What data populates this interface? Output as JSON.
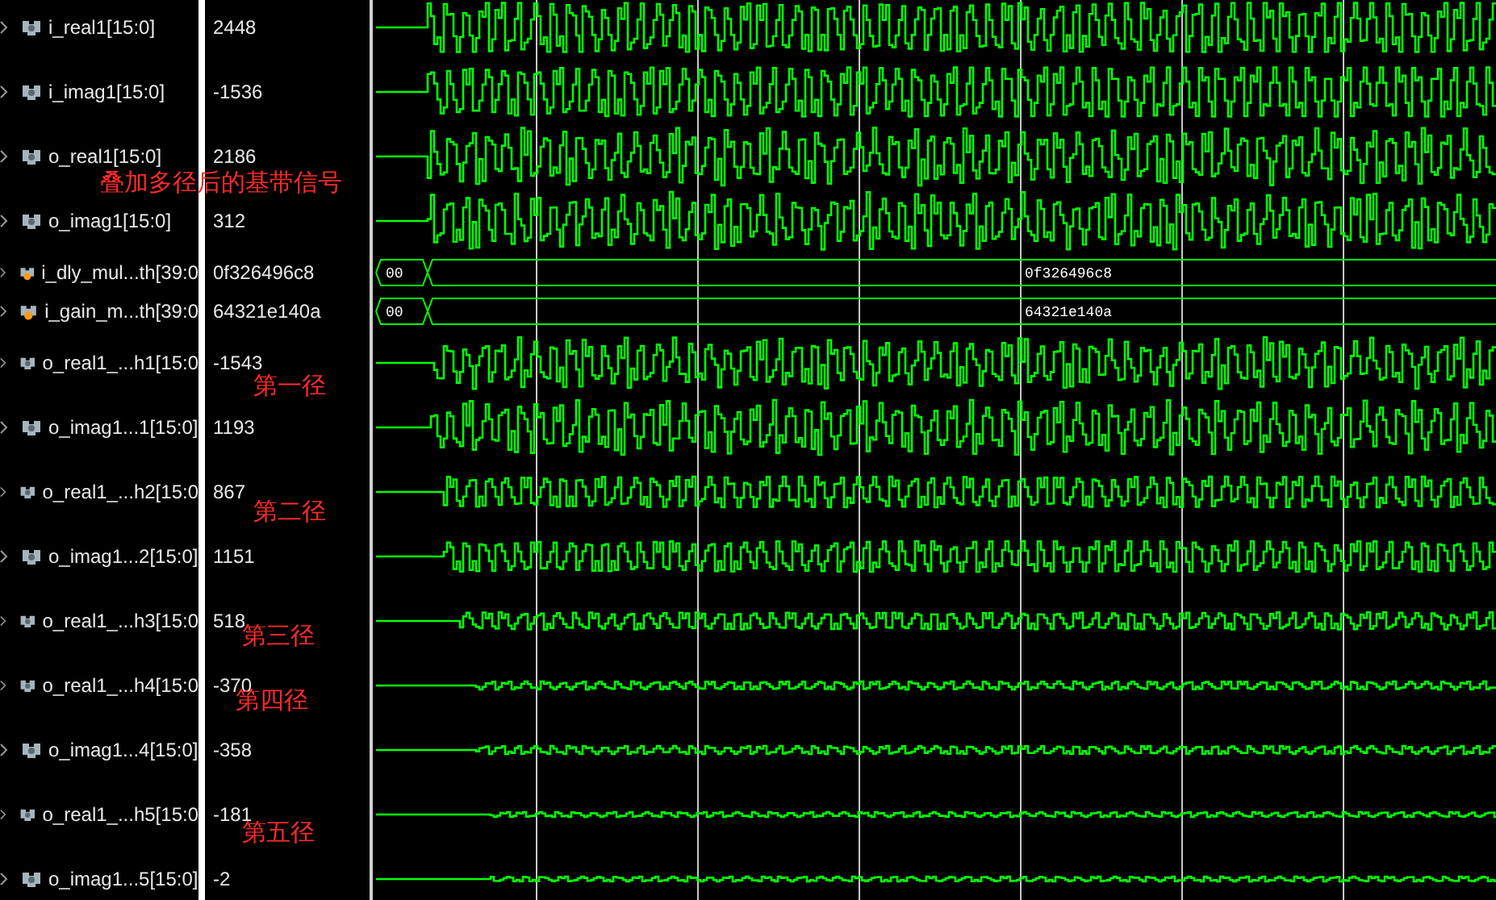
{
  "signals": [
    {
      "kind": "analog",
      "name": "i_real1[15:0]",
      "value": "2448"
    },
    {
      "kind": "analog",
      "name": "i_imag1[15:0]",
      "value": "-1536"
    },
    {
      "kind": "analog",
      "name": "o_real1[15:0]",
      "value": "2186"
    },
    {
      "kind": "analog",
      "name": "o_imag1[15:0]",
      "value": "312"
    },
    {
      "kind": "bus",
      "name": "i_dly_mul...th[39:0",
      "value": "0f326496c8",
      "segments": [
        "00",
        "0f326496c8"
      ]
    },
    {
      "kind": "bus",
      "name": "i_gain_m...th[39:0",
      "value": "64321e140a",
      "segments": [
        "00",
        "64321e140a"
      ]
    },
    {
      "kind": "analog",
      "name": "o_real1_...h1[15:0",
      "value": "-1543"
    },
    {
      "kind": "analog",
      "name": "o_imag1...1[15:0]",
      "value": "1193"
    },
    {
      "kind": "analog",
      "name": "o_real1_...h2[15:0",
      "value": "867"
    },
    {
      "kind": "analog",
      "name": "o_imag1...2[15:0]",
      "value": "1151"
    },
    {
      "kind": "analog",
      "name": "o_real1_...h3[15:0",
      "value": "518"
    },
    {
      "kind": "analog",
      "name": "o_real1_...h4[15:0",
      "value": "-370"
    },
    {
      "kind": "analog",
      "name": "o_imag1...4[15:0]",
      "value": "-358"
    },
    {
      "kind": "analog",
      "name": "o_real1_...h5[15:0",
      "value": "-181"
    },
    {
      "kind": "analog",
      "name": "o_imag1...5[15:0]",
      "value": "-2"
    }
  ],
  "annotations": [
    {
      "text": "叠加多径后的基带信号"
    },
    {
      "text": "第一径"
    },
    {
      "text": "第二径"
    },
    {
      "text": "第三径"
    },
    {
      "text": "第四径"
    },
    {
      "text": "第五径"
    }
  ]
}
